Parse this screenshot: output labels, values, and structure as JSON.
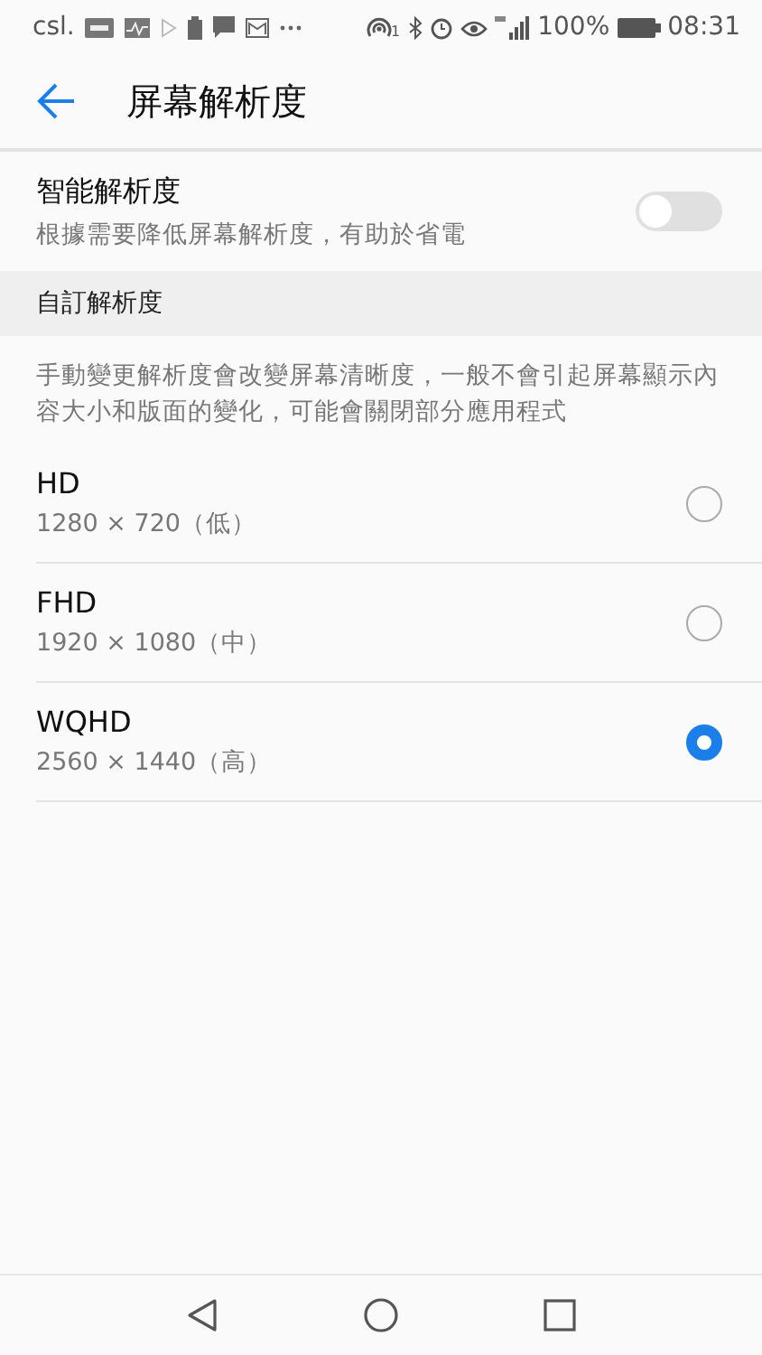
{
  "status_bar": {
    "carrier": "csl.",
    "hotspot_count": "1",
    "battery": "100%",
    "time": "08:31"
  },
  "header": {
    "title": "屏幕解析度"
  },
  "smart_resolution": {
    "title": "智能解析度",
    "subtitle": "根據需要降低屏幕解析度，有助於省電",
    "on": false
  },
  "section": {
    "title": "自訂解析度",
    "description": "手動變更解析度會改變屏幕清晰度，一般不會引起屏幕顯示內容大小和版面的變化，可能會關閉部分應用程式"
  },
  "options": [
    {
      "name": "HD",
      "detail": "1280 × 720（低）",
      "selected": false
    },
    {
      "name": "FHD",
      "detail": "1920 × 1080（中）",
      "selected": false
    },
    {
      "name": "WQHD",
      "detail": "2560 × 1440（高）",
      "selected": true
    }
  ]
}
